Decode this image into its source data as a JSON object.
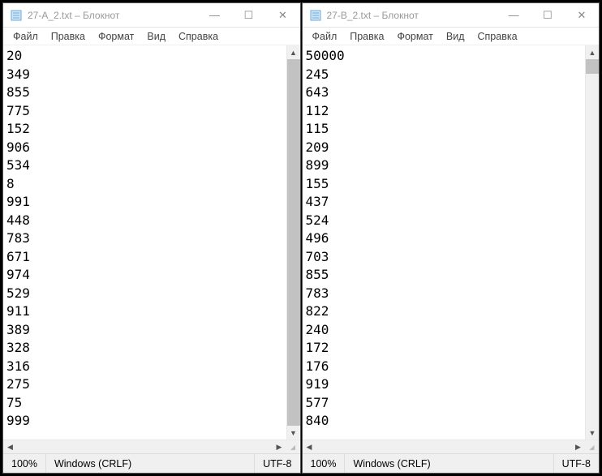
{
  "menu": {
    "file": "Файл",
    "edit": "Правка",
    "format": "Формат",
    "view": "Вид",
    "help": "Справка"
  },
  "windows": [
    {
      "title": "27-A_2.txt – Блокнот",
      "lines": [
        "20",
        "349",
        "855",
        "775",
        "152",
        "906",
        "534",
        "8",
        "991",
        "448",
        "783",
        "671",
        "974",
        "529",
        "911",
        "389",
        "328",
        "316",
        "275",
        "75",
        "999"
      ],
      "thumb": {
        "top": 0,
        "height": 100
      },
      "status": {
        "zoom": "100%",
        "eol": "Windows (CRLF)",
        "enc": "UTF-8"
      }
    },
    {
      "title": "27-B_2.txt – Блокнот",
      "lines": [
        "50000",
        "245",
        "643",
        "112",
        "115",
        "209",
        "899",
        "155",
        "437",
        "524",
        "496",
        "703",
        "855",
        "783",
        "822",
        "240",
        "172",
        "176",
        "919",
        "577",
        "840"
      ],
      "thumb": {
        "top": 0,
        "height": 4
      },
      "status": {
        "zoom": "100%",
        "eol": "Windows (CRLF)",
        "enc": "UTF-8"
      }
    }
  ]
}
